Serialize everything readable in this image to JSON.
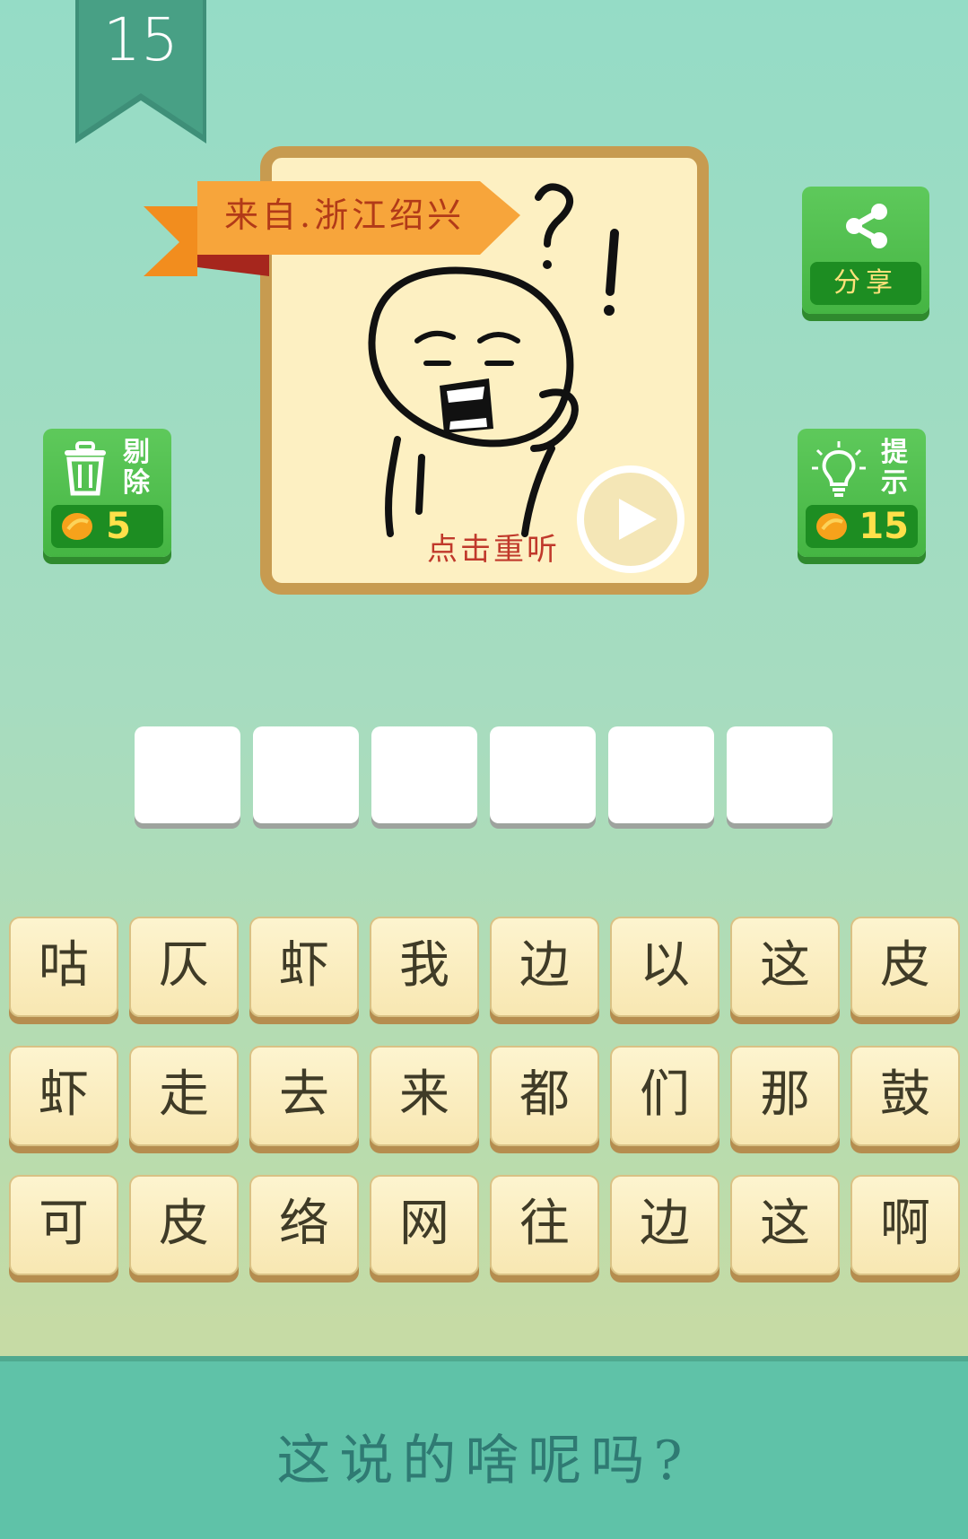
{
  "level": "15",
  "puzzle": {
    "origin_banner": "来自.浙江绍兴",
    "replay_label": "点击重听"
  },
  "share_button": {
    "label": "分享",
    "icon": "share-icon"
  },
  "delete_button": {
    "label_line1": "剔",
    "label_line2": "除",
    "cost": "5",
    "icon": "trash-icon"
  },
  "hint_button": {
    "label_line1": "提",
    "label_line2": "示",
    "cost": "15",
    "icon": "lightbulb-icon"
  },
  "answer_slots": [
    "",
    "",
    "",
    "",
    "",
    ""
  ],
  "char_rows": [
    [
      "咕",
      "仄",
      "虾",
      "我",
      "边",
      "以",
      "这",
      "皮"
    ],
    [
      "虾",
      "走",
      "去",
      "来",
      "都",
      "们",
      "那",
      "鼓"
    ],
    [
      "可",
      "皮",
      "络",
      "网",
      "往",
      "边",
      "这",
      "啊"
    ]
  ],
  "bottom_prompt": "这说的啥呢吗?",
  "colors": {
    "background_top": "#95dcc6",
    "card_border": "#c79b50",
    "button_green": "#45b543",
    "tile_face": "#fdf4cf",
    "bottom_bar": "#5fc2a8"
  }
}
